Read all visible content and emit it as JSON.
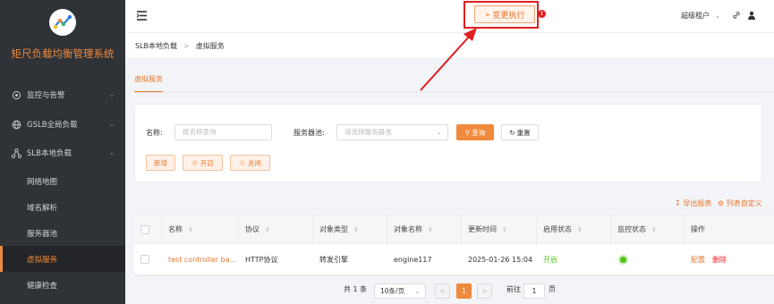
{
  "app": {
    "title": "矩尺负载均衡管理系统"
  },
  "sidebar": {
    "groups": [
      {
        "label": "监控与告警",
        "icon": "target-icon",
        "expanded": false
      },
      {
        "label": "GSLB全局负载",
        "icon": "globe-icon",
        "expanded": false
      },
      {
        "label": "SLB本地负载",
        "icon": "nodes-icon",
        "expanded": true
      }
    ],
    "items": [
      "网络地图",
      "域名解析",
      "服务器池",
      "虚拟服务",
      "健康检查"
    ],
    "active_item": "虚拟服务"
  },
  "topbar": {
    "exec_button": "变更执行",
    "alert": "!",
    "user": "超级租户"
  },
  "breadcrumb": [
    "SLB本地负载",
    "虚拟服务"
  ],
  "tabs": [
    "虚拟服务"
  ],
  "filters": {
    "name_label": "名称:",
    "name_placeholder": "按名称查询",
    "pool_label": "服务器池:",
    "pool_placeholder": "请选择服务器池",
    "query_button": "查询",
    "reset_button": "重置",
    "add_button": "新增",
    "enable_button": "开启",
    "disable_button": "关闭"
  },
  "table_tools": {
    "export": "导出报表",
    "customize": "列表自定义"
  },
  "table": {
    "columns": [
      "名称",
      "协议",
      "对象类型",
      "对象名称",
      "更新时间",
      "启用状态",
      "监控状态",
      "操作"
    ],
    "rows": [
      {
        "name": "test controller ba...",
        "protocol": "HTTP协议",
        "object_type": "转发引擎",
        "object_name": "engine117",
        "updated": "2025-01-26 15:04",
        "enabled": "开启",
        "monitor": "ok",
        "actions": [
          "配置",
          "删除"
        ]
      }
    ]
  },
  "pagination": {
    "total": "共 1 条",
    "page_size": "10条/页",
    "current_page": "1",
    "goto_label": "前往",
    "goto_value": "1",
    "page_suffix": "页"
  },
  "colors": {
    "accent": "#f08a3c",
    "sidebar": "#2f3237",
    "annotation": "#e01f1f",
    "success": "#52c41a",
    "danger": "#f5222d"
  }
}
